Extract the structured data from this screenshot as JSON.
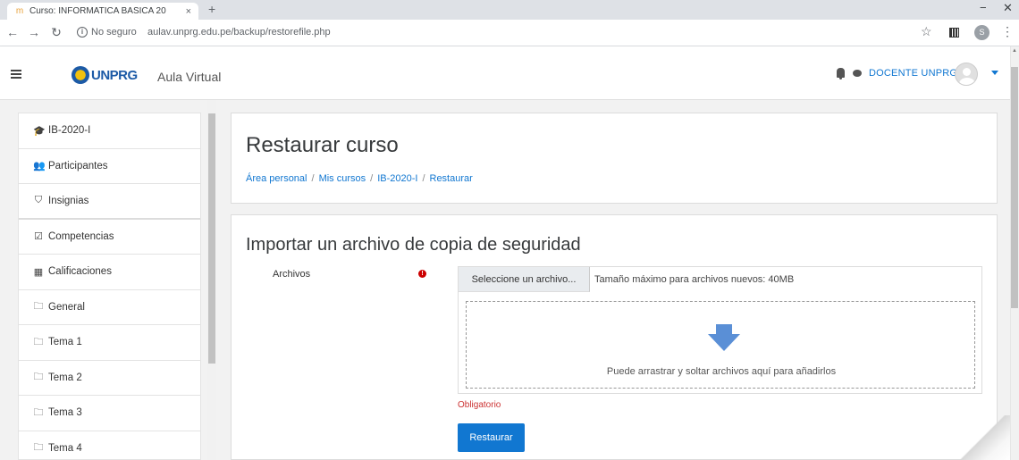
{
  "browser": {
    "tab_title": "Curso: INFORMATICA BASICA 20",
    "tab_close": "×",
    "new_tab": "+",
    "security_label": "No seguro",
    "url": "aulav.unprg.edu.pe/backup/restorefile.php",
    "profile_initial": "S"
  },
  "navbar": {
    "logo_text": "UNPRG",
    "site_name": "Aula Virtual",
    "user_name": "DOCENTE UNPRG"
  },
  "sidebar": {
    "items": [
      {
        "icon": "graduation-cap-icon",
        "label": "IB-2020-I"
      },
      {
        "icon": "users-icon",
        "label": "Participantes"
      },
      {
        "icon": "shield-icon",
        "label": "Insignias"
      },
      {
        "icon": "checkbox-icon",
        "label": "Competencias"
      },
      {
        "icon": "table-icon",
        "label": "Calificaciones"
      },
      {
        "icon": "folder-icon",
        "label": "General"
      },
      {
        "icon": "folder-icon",
        "label": "Tema 1"
      },
      {
        "icon": "folder-icon",
        "label": "Tema 2"
      },
      {
        "icon": "folder-icon",
        "label": "Tema 3"
      },
      {
        "icon": "folder-icon",
        "label": "Tema 4"
      }
    ]
  },
  "header": {
    "title": "Restaurar curso",
    "breadcrumb": [
      "Área personal",
      "Mis cursos",
      "IB-2020-I",
      "Restaurar"
    ],
    "breadcrumb_sep": "/"
  },
  "import": {
    "title": "Importar un archivo de copia de seguridad",
    "field_label": "Archivos",
    "select_button": "Seleccione un archivo...",
    "max_size": "Tamaño máximo para archivos nuevos: 40MB",
    "drop_text": "Puede arrastrar y soltar archivos aquí para añadirlos",
    "required": "Obligatorio",
    "submit": "Restaurar"
  },
  "colors": {
    "accent": "#1177d1",
    "required": "#cc3333",
    "arrow": "#5a8fd6"
  }
}
